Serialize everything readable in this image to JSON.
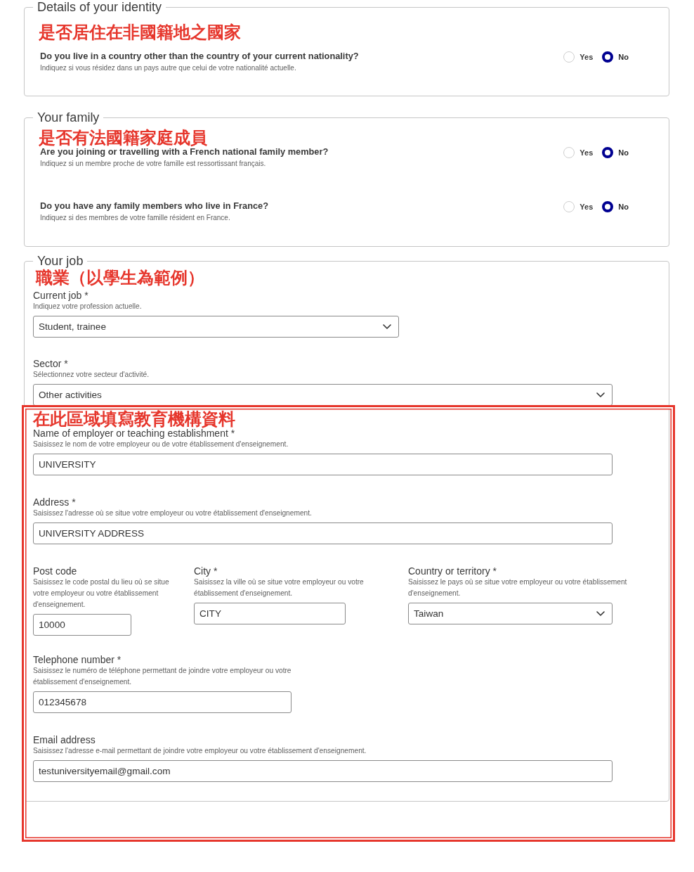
{
  "sections": [
    {
      "kind": "questions",
      "legend": "Details of your identity",
      "annotation": "是否居住在非國籍地之國家",
      "questions": [
        {
          "text": "Do you live in a country other than the country of your current nationality?",
          "hint": "Indiquez si vous résidez dans un pays autre que celui de votre nationalité actuelle.",
          "options": [
            {
              "label": "Yes",
              "selected": false
            },
            {
              "label": "No",
              "selected": true
            }
          ]
        }
      ]
    },
    {
      "kind": "questions",
      "legend": "Your family",
      "annotation": "是否有法國籍家庭成員",
      "questions": [
        {
          "text": "Are you joining or travelling with a French national family member?",
          "hint": "Indiquez si un membre proche de votre famille est ressortissant français.",
          "options": [
            {
              "label": "Yes",
              "selected": false
            },
            {
              "label": "No",
              "selected": true
            }
          ]
        },
        {
          "text": "Do you have any family members who live in France?",
          "hint": "Indiquez si des membres de votre famille résident en France.",
          "options": [
            {
              "label": "Yes",
              "selected": false
            },
            {
              "label": "No",
              "selected": true
            }
          ]
        }
      ]
    },
    {
      "kind": "fields",
      "legend": "Your job",
      "annotation": "職業（以學生為範例）",
      "fields": [
        {
          "kind": "select",
          "label": "Current job *",
          "hint": "Indiquez votre profession actuelle.",
          "value": "Student, trainee"
        },
        {
          "kind": "select",
          "label": "Sector *",
          "hint": "Sélectionnez votre secteur d'activité.",
          "value": "Other activities"
        }
      ],
      "highlight": {
        "annotation": "在此區域填寫教育機構資料",
        "rows": [
          [
            {
              "kind": "text",
              "label": "Name of employer or teaching establishment *",
              "hint": "Saisissez le nom de votre employeur ou de votre établissement d'enseignement.",
              "value": "UNIVERSITY"
            }
          ],
          [
            {
              "kind": "text",
              "label": "Address *",
              "hint": "Saisissez l'adresse où se situe votre employeur ou votre établissement d'enseignement.",
              "value": "UNIVERSITY ADDRESS"
            }
          ],
          [
            {
              "kind": "text",
              "label": "Post code",
              "hint": "Saisissez le code postal du lieu où se situe votre employeur ou votre établissement d'enseignement.",
              "value": "10000"
            },
            {
              "kind": "text",
              "label": "City *",
              "hint": "Saisissez la ville où se situe votre employeur ou votre établissement d'enseignement.",
              "value": "CITY"
            },
            {
              "kind": "select",
              "label": "Country or territory *",
              "hint": "Saisissez le pays où se situe votre employeur ou votre établissement d'enseignement.",
              "value": "Taiwan"
            }
          ],
          [
            {
              "kind": "text",
              "label": "Telephone number *",
              "hint": "Saisissez le numéro de téléphone permettant de joindre votre employeur ou votre établissement d'enseignement.",
              "value": "012345678"
            }
          ],
          [
            {
              "kind": "text",
              "label": "Email address",
              "hint": "Saisissez l'adresse e-mail permettant de joindre votre employeur ou votre établissement d'enseignement.",
              "value": "testuniversityemail@gmail.com"
            }
          ]
        ]
      }
    }
  ]
}
